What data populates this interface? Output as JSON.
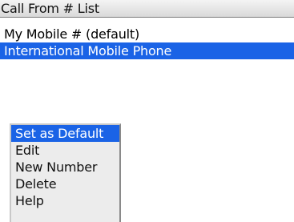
{
  "title_bar": {
    "title": "Call From # List"
  },
  "list": {
    "items": [
      {
        "label": "My Mobile # (default)"
      },
      {
        "label": "International Mobile Phone"
      }
    ],
    "selected_index": 1
  },
  "context_menu": {
    "items": [
      {
        "label": "Set as Default"
      },
      {
        "label": "Edit"
      },
      {
        "label": "New Number"
      },
      {
        "label": "Delete"
      },
      {
        "label": "Help"
      }
    ],
    "selected_index": 0
  },
  "colors": {
    "selection": "#1a63e6",
    "menu_background": "#ececec"
  }
}
